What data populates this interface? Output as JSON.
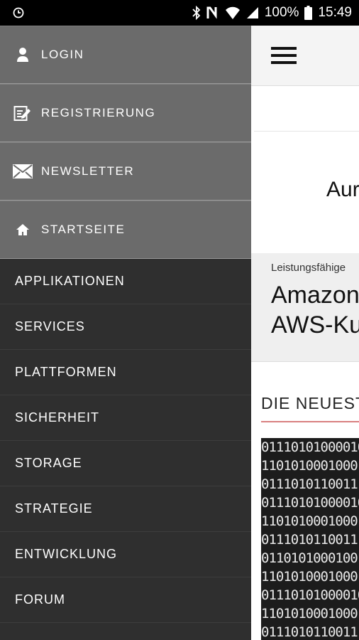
{
  "status_bar": {
    "battery": "100%",
    "time": "15:49"
  },
  "drawer": {
    "account_items": [
      {
        "label": "LOGIN",
        "icon": "user-icon"
      },
      {
        "label": "REGISTRIERUNG",
        "icon": "edit-icon"
      },
      {
        "label": "NEWSLETTER",
        "icon": "mail-icon"
      },
      {
        "label": "STARTSEITE",
        "icon": "home-icon"
      }
    ],
    "nav_items": [
      "APPLIKATIONEN",
      "SERVICES",
      "PLATTFORMEN",
      "SICHERHEIT",
      "STORAGE",
      "STRATEGIE",
      "ENTWICKLUNG",
      "FORUM"
    ]
  },
  "main": {
    "ad_text": "Aur",
    "feature": {
      "kicker": "Leistungsfähige",
      "headline_line1": "Amazon",
      "headline_line2": "AWS-Ku"
    },
    "section_title": "DIE NEUEST",
    "binary_rows": [
      "01110101000010",
      "1101010001000",
      "0111010110011",
      "01110101000010",
      "1101010001000",
      "0111010110011",
      "0110101000100",
      "1101010001000",
      "01110101000010",
      "1101010001000",
      "0111010110011"
    ]
  }
}
